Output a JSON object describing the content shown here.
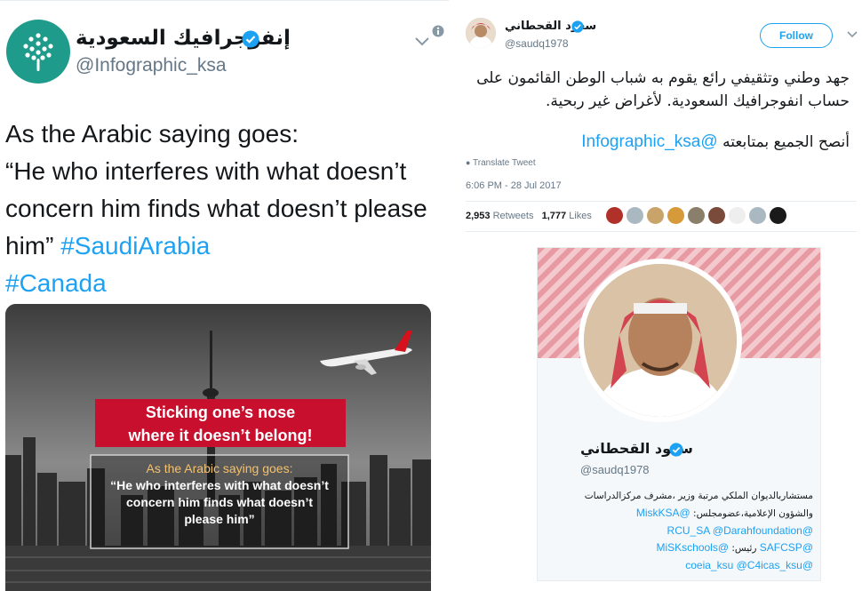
{
  "left_tweet": {
    "author_name": "إنفوجرافيك السعودية",
    "author_handle": "@Infographic_ksa",
    "text_line1": "As the Arabic saying goes:",
    "text_line2": "“He who interferes with what doesn’t",
    "text_line3": "concern him finds what doesn’t please",
    "text_line4": "him”",
    "hashtag1": "#SaudiArabia",
    "hashtag2": "#Canada",
    "image": {
      "banner_line1": "Sticking one’s nose",
      "banner_line2": "where it doesn’t belong!",
      "quote_line1": "As the Arabic saying goes:",
      "quote_line2": "“He who interferes with what doesn’t",
      "quote_line3": "concern him finds what doesn’t",
      "quote_line4": "please him”"
    },
    "accent_color": "#1da1f2"
  },
  "right_tweet": {
    "author_name": "سعود القحطاني",
    "author_handle": "@saudq1978",
    "follow_label": "Follow",
    "text_line1": "جهد وطني وتثقيفي رائع يقوم به شباب الوطن القائمون على",
    "text_line2": "حساب انفوجرافيك السعودية. لأغراض غير ربحية.",
    "text_line3": "أنصح الجميع بمتابعته",
    "mention": "@Infographic_ksa",
    "translate_label": "Translate Tweet",
    "timestamp": "6:06 PM - 28 Jul 2017",
    "retweets_count": "2,953",
    "retweets_label": "Retweets",
    "likes_count": "1,777",
    "likes_label": "Likes",
    "profile_card": {
      "name": "سعود القحطاني",
      "handle": "@saudq1978",
      "bio_line1": "مستشاربالديوان الملكي مرتبة وزير ،مشرف مركزالدراسات",
      "bio_line2_text": "والشؤون الإعلامية،عضومجلس:",
      "bio_line2_mention": "@MiskKSA",
      "bio_line3": "@RCU_SA @Darahfoundation",
      "bio_line4_mention1": "@SAFCSP",
      "bio_line4_text": "رئيس:",
      "bio_line4_mention2": "@MiSKschools",
      "bio_line5": "@coeia_ksu @C4icas_ksu"
    }
  }
}
